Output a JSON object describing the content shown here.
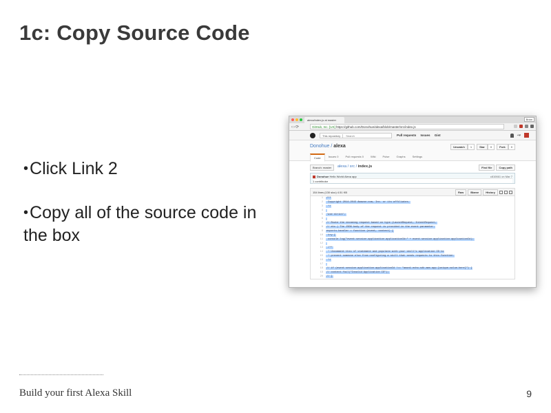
{
  "slide": {
    "title": "1c: Copy Source Code",
    "bullets": [
      "Click Link 2",
      "Copy all of the source code in the box"
    ],
    "footer": "Build your first Alexa Skill",
    "page_number": "9"
  },
  "browser": {
    "tab_title": "alexa/index.js at master",
    "user": "Brian",
    "url_secure": "GitHub, Inc. [US]",
    "url": "https://github.com/Donohue/alexa/blob/master/src/index.js",
    "header": {
      "search_scope": "This repository",
      "search_placeholder": "Search",
      "nav": [
        "Pull requests",
        "Issues",
        "Gist"
      ]
    },
    "repo": {
      "owner": "Donohue",
      "separator": " / ",
      "name": "alexa",
      "unwatch": "Unwatch",
      "unwatch_count": "1",
      "star": "Star",
      "star_count": "0",
      "fork": "Fork",
      "fork_count": "0",
      "tabs": [
        "Code",
        "Issues 0",
        "Pull requests 0",
        "Wiki",
        "Pulse",
        "Graphs",
        "Settings"
      ]
    },
    "file": {
      "branch": "Branch: master",
      "path_repo": "alexa",
      "path_dir": " / src / ",
      "path_file": "index.js",
      "find_file": "Find file",
      "copy_path": "Copy path",
      "commit_author": "Donohue",
      "commit_message": "Hello World Alexa app",
      "commit_hash": "c810661",
      "commit_date": "on Mar 7",
      "contributors": "1 contributor",
      "meta": "154 lines (130 sloc)    4.51 KB",
      "raw": "Raw",
      "blame": "Blame",
      "history": "History",
      "code_lines": [
        {
          "n": "1",
          "t": "/**"
        },
        {
          "n": "2",
          "t": " Copyright 2014-2015 Amazon.com, Inc. or its affiliates."
        },
        {
          "n": "3",
          "t": " */"
        },
        {
          "n": "4",
          "t": ""
        },
        {
          "n": "5",
          "t": "'use strict';"
        },
        {
          "n": "6",
          "t": ""
        },
        {
          "n": "7",
          "t": "// Route the incoming request based on type (LaunchRequest, IntentRequest,"
        },
        {
          "n": "8",
          "t": "// etc.) The JSON body of the request is provided in the event parameter."
        },
        {
          "n": "9",
          "t": "exports.handler = function (event, context) {"
        },
        {
          "n": "10",
          "t": "    try {"
        },
        {
          "n": "11",
          "t": "        console.log(\"event.session.application.applicationId=\" + event.session.application.applicationId);"
        },
        {
          "n": "12",
          "t": ""
        },
        {
          "n": "13",
          "t": "        /**"
        },
        {
          "n": "14",
          "t": "         * Uncomment this if statement and populate with your skill's application ID to"
        },
        {
          "n": "15",
          "t": "         * prevent someone else from configuring a skill that sends requests to this function."
        },
        {
          "n": "16",
          "t": "         */"
        },
        {
          "n": "17",
          "t": ""
        },
        {
          "n": "18",
          "t": "//     if (event.session.application.applicationId !== \"amzn1.echo-sdk-ams.app.[unique-value-here]\") {"
        },
        {
          "n": "19",
          "t": "//         context.fail(\"Invalid Application ID\");"
        },
        {
          "n": "20",
          "t": "//     }"
        }
      ]
    }
  },
  "colors": {
    "accent": "#4078c0",
    "selection": "#b4d5fe",
    "tab_highlight": "#d26911"
  }
}
